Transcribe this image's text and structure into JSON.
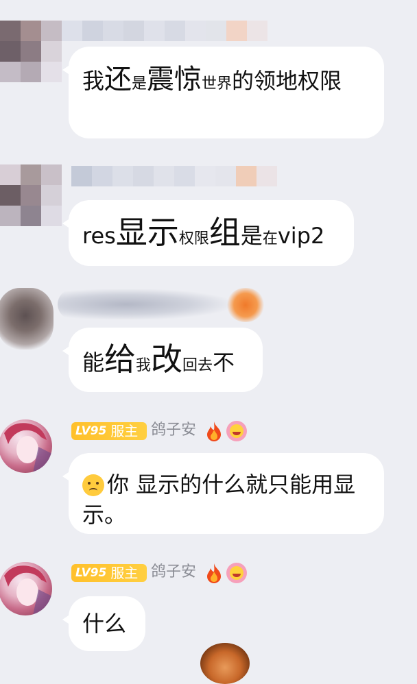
{
  "messages": [
    {
      "segments": [
        {
          "t": "我",
          "s": ""
        },
        {
          "t": "还",
          "s": "s-lg"
        },
        {
          "t": "是",
          "s": "s-sm"
        },
        {
          "t": "震惊",
          "s": "s-lg"
        },
        {
          "t": "世界",
          "s": "s-sm"
        },
        {
          "t": "的领地权限",
          "s": ""
        }
      ]
    },
    {
      "segments": [
        {
          "t": "res",
          "s": ""
        },
        {
          "t": "显示",
          "s": "s-xl"
        },
        {
          "t": "权限",
          "s": "s-sm"
        },
        {
          "t": "组",
          "s": "s-xl"
        },
        {
          "t": "是",
          "s": ""
        },
        {
          "t": "在",
          "s": "s-sm"
        },
        {
          "t": "vip2",
          "s": ""
        }
      ]
    },
    {
      "segments": [
        {
          "t": "能",
          "s": ""
        },
        {
          "t": "给",
          "s": "s-xl"
        },
        {
          "t": "我",
          "s": "s-sm"
        },
        {
          "t": "改",
          "s": "s-xl"
        },
        {
          "t": "回去",
          "s": "s-sm"
        },
        {
          "t": "不",
          "s": ""
        }
      ]
    },
    {
      "text": "你 显示的什么就只能用显示。"
    },
    {
      "text": "什么"
    }
  ],
  "sender": {
    "level_badge": "LV95",
    "title_badge": "服主",
    "name": "鸽子安"
  },
  "icons": {
    "fire": "fire-icon",
    "emoji": "grin-emoji-icon",
    "sad": "sad-face-emoji"
  },
  "colors": {
    "background": "#edeef3",
    "bubble": "#ffffff",
    "badge": "#ffc02b",
    "name": "#8a8c94"
  }
}
